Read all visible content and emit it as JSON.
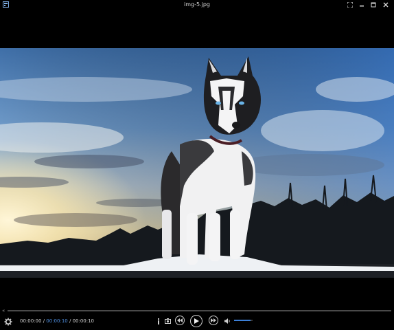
{
  "window": {
    "title": "img-5.jpg",
    "icons": [
      "app-icon",
      "fullscreen-icon",
      "minimize-icon",
      "maximize-icon",
      "close-icon"
    ]
  },
  "viewer": {
    "image_subject": "siberian husky standing on snow at sunset"
  },
  "playback": {
    "current_time": "00:00:00",
    "separator": "/",
    "duration": "00:00:10",
    "elapsed_display": "00:00:10",
    "progress": 0.0,
    "volume": 0.9
  },
  "colors": {
    "accent": "#3c80d8",
    "background": "#000000",
    "text": "#cfcfcf"
  }
}
